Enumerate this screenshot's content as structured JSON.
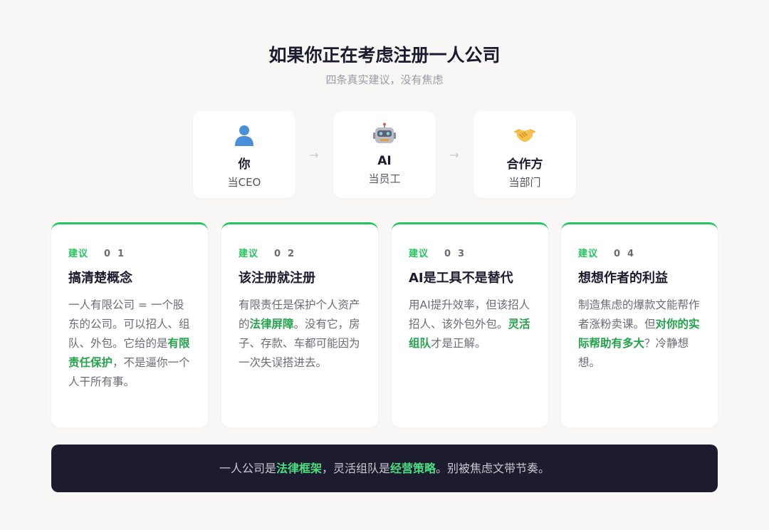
{
  "header": {
    "title": "如果你正在考虑注册一人公司",
    "subtitle": "四条真实建议，没有焦虑"
  },
  "roles": [
    {
      "icon": "person-icon",
      "name": "你",
      "desc": "当CEO"
    },
    {
      "icon": "robot-icon",
      "name": "AI",
      "desc": "当员工"
    },
    {
      "icon": "handshake-icon",
      "name": "合作方",
      "desc": "当部门"
    }
  ],
  "arrow_glyph": "→",
  "cards": [
    {
      "tag": "建议",
      "num": "01",
      "title": "搞清楚概念",
      "text": [
        {
          "t": "一人有限公司 = 一个股东的公司。可以招人、组队、外包。它给的是"
        },
        {
          "t": "有限责任保护",
          "hl": true
        },
        {
          "t": "，不是逼你一个人干所有事。"
        }
      ]
    },
    {
      "tag": "建议",
      "num": "02",
      "title": "该注册就注册",
      "text": [
        {
          "t": "有限责任是保护个人资产的"
        },
        {
          "t": "法律屏障",
          "hl": true
        },
        {
          "t": "。没有它，房子、存款、车都可能因为一次失误搭进去。"
        }
      ]
    },
    {
      "tag": "建议",
      "num": "03",
      "title": "AI是工具不是替代",
      "text": [
        {
          "t": "用AI提升效率，但该招人招人、该外包外包。"
        },
        {
          "t": "灵活组队",
          "hl": true
        },
        {
          "t": "才是正解。"
        }
      ]
    },
    {
      "tag": "建议",
      "num": "04",
      "title": "想想作者的利益",
      "text": [
        {
          "t": "制造焦虑的爆款文能帮作者涨粉卖课。但"
        },
        {
          "t": "对你的实际帮助有多大",
          "hl": true
        },
        {
          "t": "？冷静想想。"
        }
      ]
    }
  ],
  "footer": {
    "text": [
      {
        "t": "一人公司是"
      },
      {
        "t": "法律框架",
        "hl": true
      },
      {
        "t": "，灵活组队是"
      },
      {
        "t": "经营策略",
        "hl": true
      },
      {
        "t": "。别被焦虑文带节奏。"
      }
    ]
  },
  "colors": {
    "accent": "#22c55e",
    "highlight_text": "#22a34a",
    "footer_bg": "#1c1c2e",
    "page_bg": "#f8f7f5"
  }
}
